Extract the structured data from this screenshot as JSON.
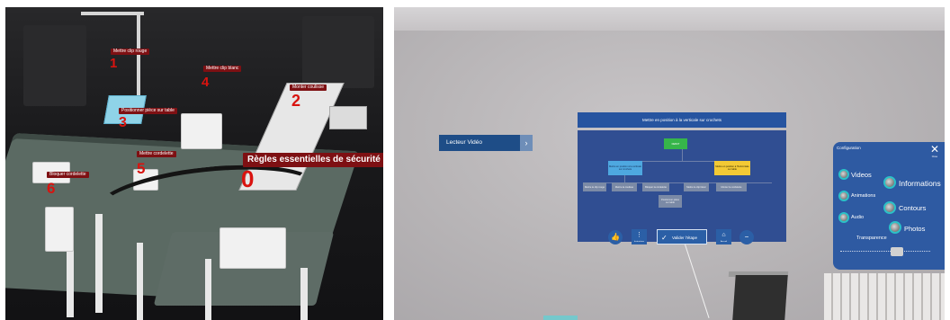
{
  "left_view": {
    "labels": {
      "mettre_clip_rouge": "Mettre clip rouge",
      "mettre_clip_blanc": "Mettre clip blanc",
      "monter_coulisse": "Monter coulisse",
      "positionner_piece": "Positionner pièce sur table",
      "mettre_cordelette": "Mettre cordelette",
      "bloquer_cordelette": "Bloquer cordelette",
      "regles": "Règles essentielles de sécurité"
    },
    "numbers": {
      "n0": "0",
      "n1": "1",
      "n2": "2",
      "n3": "3",
      "n4": "4",
      "n5": "5",
      "n6": "6"
    }
  },
  "right_view": {
    "lecteur_video": {
      "label": "Lecteur Vidéo",
      "chevron": "›"
    },
    "procedure": {
      "title": "Mettre en position à la verticale sur crochets",
      "nodes": {
        "start": "DEBUT",
        "blue": "Mettre en position à la verticale sur crochets",
        "yellow": "Mettre en position à l'horizontale sur table",
        "g1": "Mettre le clip rouge",
        "g2": "Mettre la coulisse",
        "g3": "Bloquer la cordelette",
        "g4": "Mettre le clip blanc",
        "g5": "Monter la cordelette",
        "g6": "Positionner pièce sur table"
      }
    },
    "toolbar": {
      "like_icon": "thumbs-up-icon",
      "button2_sub": "Instructions",
      "valider_label": "Valider l'étape",
      "button4_sub": "Accueil",
      "minus": "−"
    },
    "configuration": {
      "title": "Configuration",
      "close_label": "Close",
      "close_glyph": "✕",
      "options": {
        "videos": "Videos",
        "informations": "Informations",
        "animations": "Animations",
        "contours": "Contours",
        "audio": "Audio",
        "photos": "Photos"
      },
      "transparence": "Transparence"
    },
    "colors": {
      "panel_blue": "#2e5aa2",
      "accent_cyan": "#2cc1c7",
      "label_red": "#7e1013"
    }
  }
}
